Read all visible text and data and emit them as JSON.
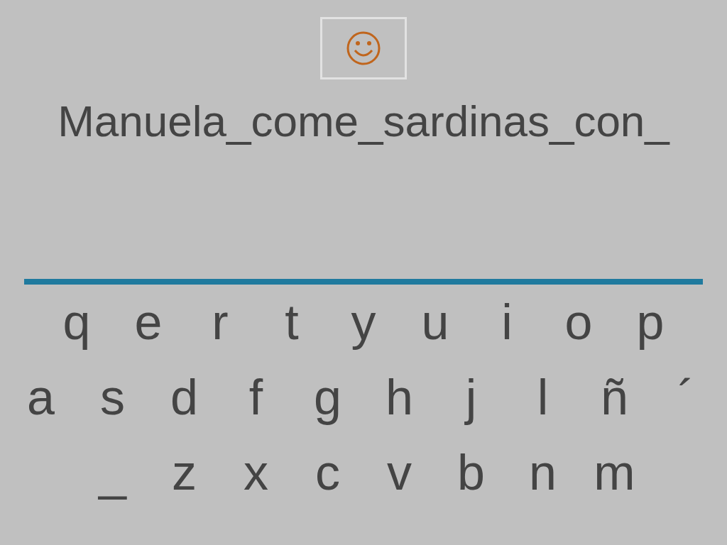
{
  "sentence": "Manuela_come_sardinas_con_",
  "keyboard": {
    "rows": [
      [
        "q",
        "e",
        "r",
        "t",
        "y",
        "u",
        "i",
        "o",
        "p"
      ],
      [
        "a",
        "s",
        "d",
        "f",
        "g",
        "h",
        "j",
        "l",
        "ñ",
        "´"
      ],
      [
        "_",
        "z",
        "x",
        "c",
        "v",
        "b",
        "n",
        "m"
      ]
    ]
  }
}
